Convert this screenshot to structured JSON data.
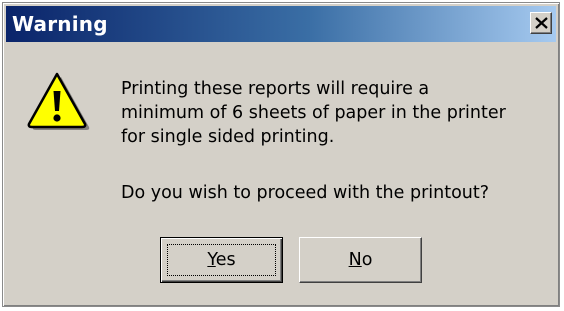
{
  "window": {
    "title": "Warning"
  },
  "titlebar": {
    "close_icon": "close-x-icon"
  },
  "content": {
    "icon": "warning-exclamation-icon",
    "message_lines": [
      "Printing these reports will require a",
      "minimum of 6 sheets of paper in the printer",
      "for single sided printing."
    ],
    "question": "Do you wish to proceed with the printout?"
  },
  "buttons": {
    "yes": {
      "mnemonic": "Y",
      "rest": "es"
    },
    "no": {
      "mnemonic": "N",
      "rest": "o"
    }
  },
  "colors": {
    "titlebar_start": "#0a246a",
    "titlebar_end": "#a6caf0",
    "dialog_bg": "#d4d0c8",
    "icon_yellow": "#ffff00"
  }
}
